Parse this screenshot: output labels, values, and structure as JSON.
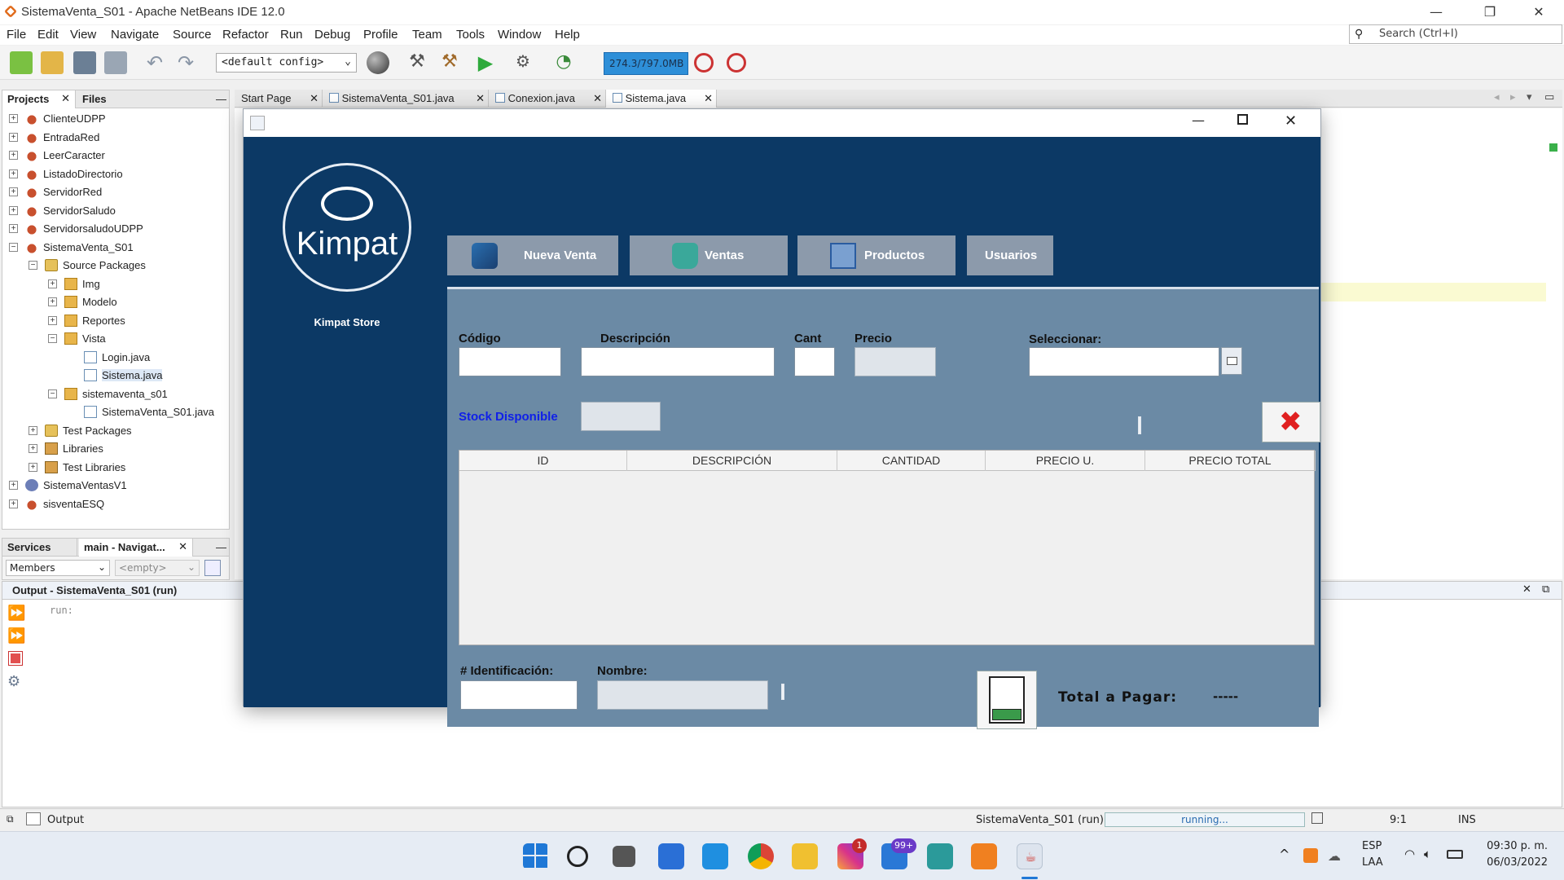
{
  "ide": {
    "title": "SistemaVenta_S01 - Apache NetBeans IDE 12.0",
    "menu": [
      "File",
      "Edit",
      "View",
      "Navigate",
      "Source",
      "Refactor",
      "Run",
      "Debug",
      "Profile",
      "Team",
      "Tools",
      "Window",
      "Help"
    ],
    "search_placeholder": "Search (Ctrl+I)",
    "config": "<default config>",
    "memory": "274.3/797.0MB",
    "projects_tab": "Projects",
    "files_tab": "Files",
    "tree": [
      {
        "label": "ClienteUDPP",
        "icon": "coffee"
      },
      {
        "label": "EntradaRed",
        "icon": "coffee"
      },
      {
        "label": "LeerCaracter",
        "icon": "coffee"
      },
      {
        "label": "ListadoDirectorio",
        "icon": "coffee"
      },
      {
        "label": "ServidorRed",
        "icon": "coffee"
      },
      {
        "label": "ServidorSaludo",
        "icon": "coffee"
      },
      {
        "label": "ServidorsaludoUDPP",
        "icon": "coffee"
      },
      {
        "label": "SistemaVenta_S01",
        "icon": "coffee"
      },
      {
        "label": "Source Packages",
        "icon": "folder"
      },
      {
        "label": "Img",
        "icon": "pkg"
      },
      {
        "label": "Modelo",
        "icon": "pkg"
      },
      {
        "label": "Reportes",
        "icon": "pkg"
      },
      {
        "label": "Vista",
        "icon": "pkg"
      },
      {
        "label": "Login.java",
        "icon": "file"
      },
      {
        "label": "Sistema.java",
        "icon": "file"
      },
      {
        "label": "sistemaventa_s01",
        "icon": "pkg"
      },
      {
        "label": "SistemaVenta_S01.java",
        "icon": "file"
      },
      {
        "label": "Test Packages",
        "icon": "folder"
      },
      {
        "label": "Libraries",
        "icon": "lib"
      },
      {
        "label": "Test Libraries",
        "icon": "lib"
      },
      {
        "label": "SistemaVentasV1",
        "icon": "php"
      },
      {
        "label": "sisventaESQ",
        "icon": "coffee"
      }
    ],
    "services_tab": "Services",
    "navigator_tab": "main - Navigat...",
    "members": "Members",
    "empty": "<empty>",
    "editor_tabs": [
      "Start Page",
      "SistemaVenta_S01.java",
      "Conexion.java",
      "Sistema.java"
    ],
    "output_title": "Output - SistemaVenta_S01 (run)",
    "output_text": "run:",
    "status_output": "Output",
    "status_project": "SistemaVenta_S01 (run)",
    "status_running": "running...",
    "status_pos": "9:1",
    "status_ins": "INS"
  },
  "taskbar": {
    "lang": "ESP",
    "region": "LAA",
    "time": "09:30 p. m.",
    "date": "06/03/2022",
    "badge_instagram": "1",
    "badge_mail": "99+"
  },
  "app": {
    "logo_text": "Kimpat",
    "store_name": "Kimpat Store",
    "nav": [
      "Nueva Venta",
      "Ventas",
      "Productos",
      "Usuarios"
    ],
    "labels": {
      "codigo": "Código",
      "descripcion": "Descripción",
      "cant": "Cant",
      "precio": "Precio",
      "seleccionar": "Seleccionar:",
      "stock": "Stock Disponible",
      "identificacion": "# Identificación:",
      "nombre": "Nombre:",
      "total_pagar": "Total a Pagar:",
      "total_value": "-----"
    },
    "table_columns": [
      "ID",
      "DESCRIPCIÓN",
      "CANTIDAD",
      "PRECIO U.",
      "PRECIO TOTAL"
    ]
  },
  "colors": {
    "app_sidebar": "#0c3965",
    "form_panel": "#6b8aa5",
    "nav_button": "#8c9aab",
    "stock_label": "#1020e8"
  }
}
